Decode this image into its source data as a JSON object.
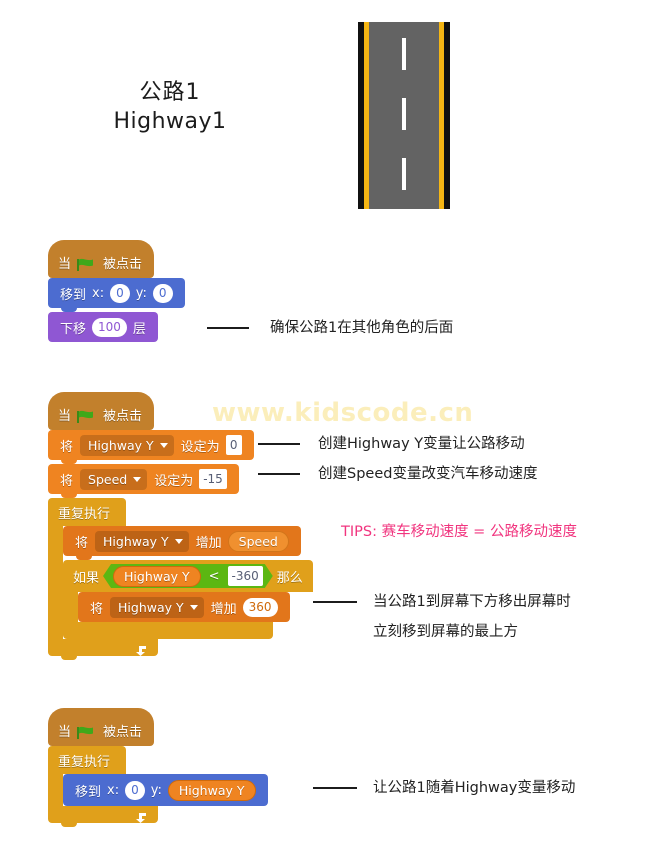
{
  "title": {
    "chinese": "公路1",
    "english": "Highway1"
  },
  "watermark": "www.kidscode.cn",
  "road": {
    "name": "highway-sprite",
    "asphalt_color": "#636363",
    "edge_color": "#111111",
    "lane_line_color": "#f5b614",
    "dash_color": "#ffffff",
    "dash_count": 3
  },
  "scripts": [
    {
      "id": "script-1",
      "blocks": {
        "hat": {
          "when": "当",
          "clicked": "被点击",
          "icon": "green-flag-icon"
        },
        "goto": {
          "label": "移到",
          "x_label": "x:",
          "x_value": "0",
          "y_label": "y:",
          "y_value": "0"
        },
        "go_back": {
          "prefix": "下移",
          "value": "100",
          "suffix": "层"
        }
      },
      "annotation": "确保公路1在其他角色的后面"
    },
    {
      "id": "script-2",
      "blocks": {
        "hat": {
          "when": "当",
          "clicked": "被点击",
          "icon": "green-flag-icon"
        },
        "set_highway": {
          "prefix": "将",
          "variable": "Highway Y",
          "middle": "设定为",
          "value": "0"
        },
        "set_speed": {
          "prefix": "将",
          "variable": "Speed",
          "middle": "设定为",
          "value": "-15"
        },
        "forever": {
          "label": "重复执行"
        },
        "change_highway": {
          "prefix": "将",
          "variable": "Highway Y",
          "middle": "增加",
          "value": "Speed"
        },
        "if_block": {
          "if_label": "如果",
          "operand_left": "Highway Y",
          "operator": "<",
          "operand_right": "-360",
          "then_label": "那么"
        },
        "change_highway_inner": {
          "prefix": "将",
          "variable": "Highway Y",
          "middle": "增加",
          "value": "360"
        }
      },
      "annotations": [
        "创建Highway Y变量让公路移动",
        "创建Speed变量改变汽车移动速度",
        "当公路1到屏幕下方移出屏幕时",
        "立刻移到屏幕的最上方"
      ],
      "tips": "TIPS:  赛车移动速度 = 公路移动速度"
    },
    {
      "id": "script-3",
      "blocks": {
        "hat": {
          "when": "当",
          "clicked": "被点击",
          "icon": "green-flag-icon"
        },
        "forever": {
          "label": "重复执行"
        },
        "goto": {
          "label": "移到",
          "x_label": "x:",
          "x_value": "0",
          "y_label": "y:",
          "y_value": "Highway Y"
        }
      },
      "annotation": "让公路1随着Highway变量移动"
    }
  ],
  "colors": {
    "events_hat": "#c2802c",
    "motion": "#4c6cd0",
    "looks": "#8f57d3",
    "variables": "#ef8421",
    "control": "#e0a01b",
    "operators": "#5cb712",
    "tips_text": "#f1357f",
    "watermark": "#fbeebb"
  }
}
